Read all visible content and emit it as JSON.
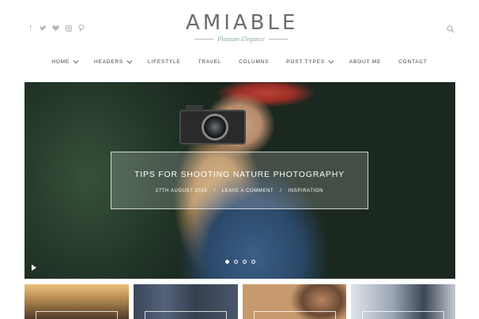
{
  "header": {
    "social_icons": [
      "facebook-icon",
      "twitter-icon",
      "heart-icon",
      "instagram-icon",
      "pinterest-icon"
    ],
    "logo_title": "AMIABLE",
    "logo_tagline": "Pleasant Elegance"
  },
  "nav": {
    "items": [
      {
        "label": "HOME",
        "dropdown": true
      },
      {
        "label": "HEADERS",
        "dropdown": true
      },
      {
        "label": "LIFESTYLE",
        "dropdown": false
      },
      {
        "label": "TRAVEL",
        "dropdown": false
      },
      {
        "label": "COLUMNS",
        "dropdown": false
      },
      {
        "label": "POST TYPES",
        "dropdown": true
      },
      {
        "label": "ABOUT ME",
        "dropdown": false
      },
      {
        "label": "CONTACT",
        "dropdown": false
      }
    ]
  },
  "slider": {
    "post_title": "TIPS FOR SHOOTING NATURE PHOTOGRAPHY",
    "date": "27TH AUGUST 2015",
    "comments": "LEAVE A COMMENT",
    "category": "INSPIRATION",
    "separator": "/",
    "slide_count": 4,
    "active_slide": 1
  },
  "colors": {
    "logo_text": "#6c6c6c",
    "tagline": "#8aa99a",
    "nav_text": "#3f3f3f"
  }
}
